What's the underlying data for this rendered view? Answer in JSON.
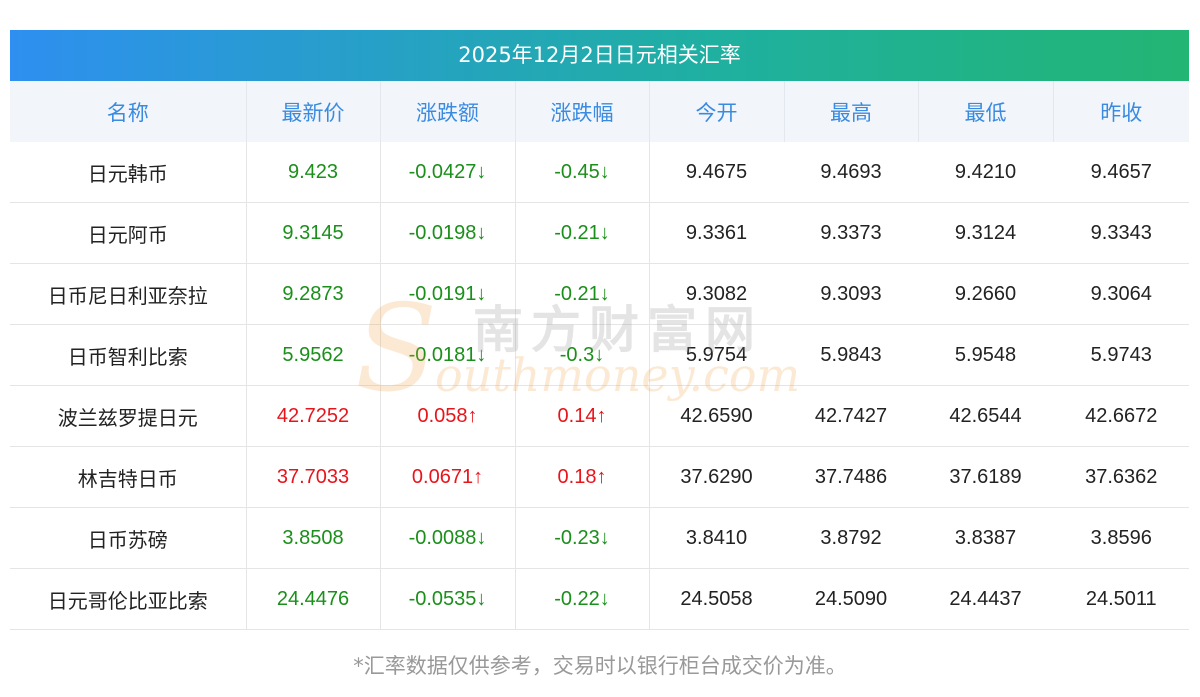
{
  "title": "2025年12月2日日元相关汇率",
  "headers": [
    "名称",
    "最新价",
    "涨跌额",
    "涨跌幅",
    "今开",
    "最高",
    "最低",
    "昨收"
  ],
  "rows": [
    {
      "name": "日元韩币",
      "latest": "9.423",
      "change": "-0.0427↓",
      "pct": "-0.45↓",
      "open": "9.4675",
      "high": "9.4693",
      "low": "9.4210",
      "prev": "9.4657",
      "dir": "down"
    },
    {
      "name": "日元阿币",
      "latest": "9.3145",
      "change": "-0.0198↓",
      "pct": "-0.21↓",
      "open": "9.3361",
      "high": "9.3373",
      "low": "9.3124",
      "prev": "9.3343",
      "dir": "down"
    },
    {
      "name": "日币尼日利亚奈拉",
      "latest": "9.2873",
      "change": "-0.0191↓",
      "pct": "-0.21↓",
      "open": "9.3082",
      "high": "9.3093",
      "low": "9.2660",
      "prev": "9.3064",
      "dir": "down"
    },
    {
      "name": "日币智利比索",
      "latest": "5.9562",
      "change": "-0.0181↓",
      "pct": "-0.3↓",
      "open": "5.9754",
      "high": "5.9843",
      "low": "5.9548",
      "prev": "5.9743",
      "dir": "down"
    },
    {
      "name": "波兰兹罗提日元",
      "latest": "42.7252",
      "change": "0.058↑",
      "pct": "0.14↑",
      "open": "42.6590",
      "high": "42.7427",
      "low": "42.6544",
      "prev": "42.6672",
      "dir": "up"
    },
    {
      "name": "林吉特日币",
      "latest": "37.7033",
      "change": "0.0671↑",
      "pct": "0.18↑",
      "open": "37.6290",
      "high": "37.7486",
      "low": "37.6189",
      "prev": "37.6362",
      "dir": "up"
    },
    {
      "name": "日币苏磅",
      "latest": "3.8508",
      "change": "-0.0088↓",
      "pct": "-0.23↓",
      "open": "3.8410",
      "high": "3.8792",
      "low": "3.8387",
      "prev": "3.8596",
      "dir": "down"
    },
    {
      "name": "日元哥伦比亚比索",
      "latest": "24.4476",
      "change": "-0.0535↓",
      "pct": "-0.22↓",
      "open": "24.5058",
      "high": "24.5090",
      "low": "24.4437",
      "prev": "24.5011",
      "dir": "down"
    }
  ],
  "footer": "*汇率数据仅供参考，交易时以银行柜台成交价为准。",
  "watermark": {
    "cn": "南方财富网",
    "en_letter": "S",
    "en": "outhmoney.com"
  },
  "colors": {
    "up": "#e8141b",
    "down": "#1a8f1a",
    "header_text": "#3a8be0"
  }
}
